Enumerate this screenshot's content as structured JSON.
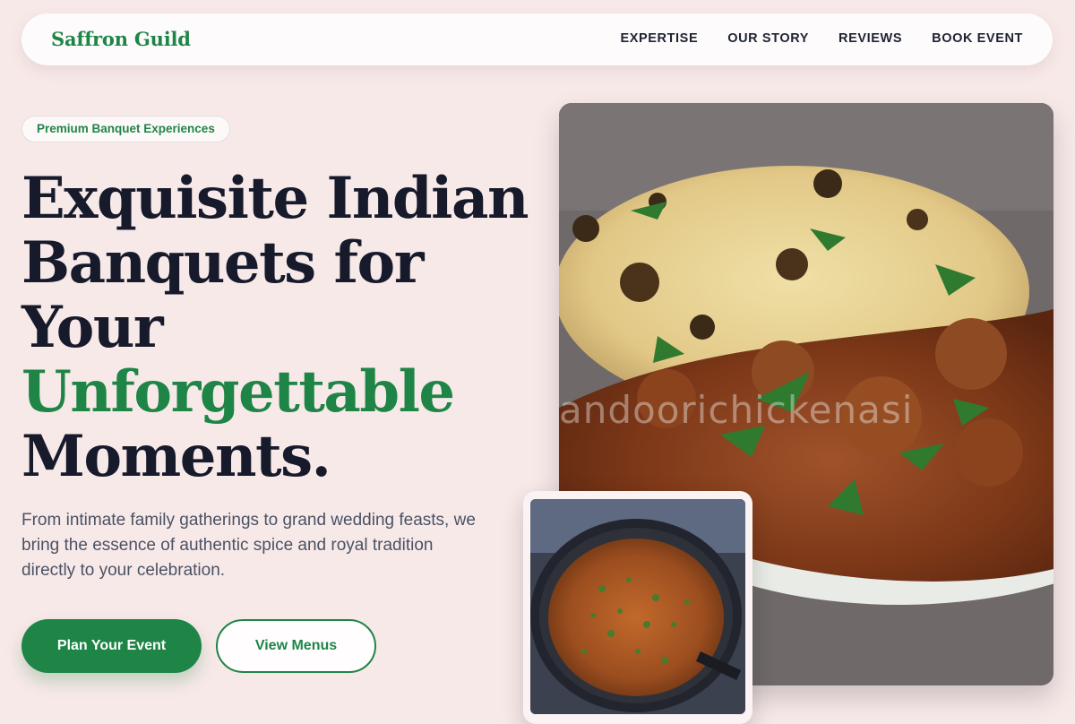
{
  "brand": {
    "name": "Saffron Guild"
  },
  "nav": {
    "items": [
      "EXPERTISE",
      "OUR STORY",
      "REVIEWS",
      "BOOK EVENT"
    ]
  },
  "hero": {
    "badge": "Premium Banquet Experiences",
    "headline_lines": [
      "Exquisite Indian",
      "Banquets for",
      "Your"
    ],
    "headline_accent": "Unforgettable",
    "headline_end": "Moments.",
    "subtext": "From intimate family gatherings to grand wedding feasts, we bring the essence of authentic spice and royal tradition directly to your celebration.",
    "cta_primary": "Plan Your Event",
    "cta_secondary": "View Menus"
  },
  "images": {
    "main_watermark": "andoorichickenasi"
  },
  "colors": {
    "accent": "#1f8547",
    "background": "#f8e9e9",
    "heading": "#161a2b",
    "body_text": "#4a5263"
  }
}
